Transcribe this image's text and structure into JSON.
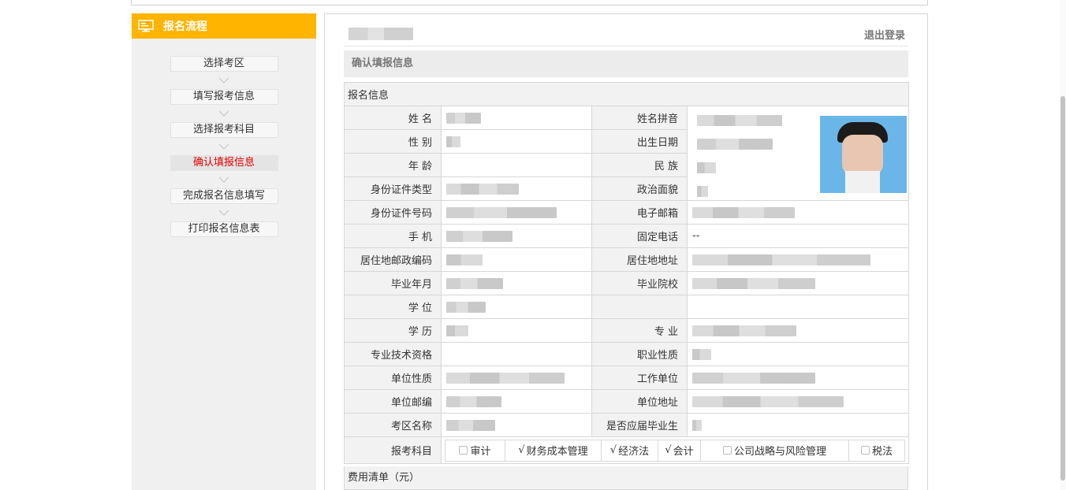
{
  "sidebar": {
    "title": "报名流程",
    "steps": [
      {
        "label": "选择考区"
      },
      {
        "label": "填写报考信息"
      },
      {
        "label": "选择报考科目"
      },
      {
        "label": "确认填报信息"
      },
      {
        "label": "完成报名信息填写"
      },
      {
        "label": "打印报名信息表"
      }
    ]
  },
  "header": {
    "logout": "退出登录"
  },
  "section": {
    "title": "确认填报信息",
    "table_title": "报名信息"
  },
  "fields": {
    "name": "姓 名",
    "pinyin": "姓名拼音",
    "gender": "性 别",
    "birth": "出生日期",
    "age": "年 龄",
    "ethnic": "民 族",
    "id_type": "身份证件类型",
    "political": "政治面貌",
    "id_no": "身份证件号码",
    "email": "电子邮箱",
    "mobile": "手 机",
    "phone": "固定电话",
    "phone_value": "--",
    "zip": "居住地邮政编码",
    "address": "居住地地址",
    "grad_month": "毕业年月",
    "school": "毕业院校",
    "degree": "学 位",
    "education": "学 历",
    "major": "专 业",
    "qualification": "专业技术资格",
    "job_type": "职业性质",
    "unit_type": "单位性质",
    "unit": "工作单位",
    "unit_zip": "单位邮编",
    "unit_address": "单位地址",
    "exam_area": "考区名称",
    "fresh_grad": "是否应届毕业生",
    "subjects_label": "报考科目"
  },
  "subjects": [
    {
      "label": "审计",
      "checked": false
    },
    {
      "label": "财务成本管理",
      "checked": true
    },
    {
      "label": "经济法",
      "checked": true
    },
    {
      "label": "会计",
      "checked": true
    },
    {
      "label": "公司战略与风险管理",
      "checked": false
    },
    {
      "label": "税法",
      "checked": false
    }
  ],
  "fee": {
    "title": "费用清单（元）"
  },
  "colors": {
    "accent": "#ffb400",
    "active_step": "#e60000"
  }
}
